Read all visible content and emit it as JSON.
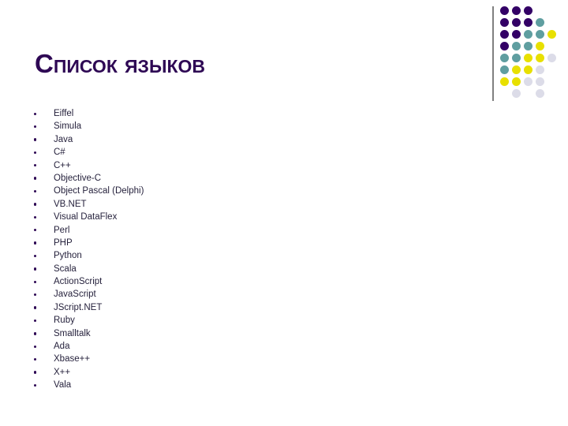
{
  "slide": {
    "title": "Список языков",
    "background_color": "#ffffff",
    "title_color": "#2E0854",
    "text_color": "#231f3a"
  },
  "languages": [
    "Eiffel",
    "Simula",
    "Java",
    "C#",
    "C++",
    "Objective-C",
    "Object Pascal (Delphi)",
    "VB.NET",
    "Visual DataFlex",
    "Perl",
    "PHP",
    "Python",
    "Scala",
    "ActionScript",
    "JavaScript",
    "JScript.NET",
    "Ruby",
    "Smalltalk",
    "Ada",
    "Xbase++",
    "X++",
    "Vala"
  ],
  "decoration": {
    "name": "dot-grid-decoration",
    "rule_color": "#808080",
    "palette": {
      "purple": "#330066",
      "teal": "#5f9ea0",
      "yellow": "#e8e000",
      "lavender": "#dcdce8"
    },
    "columns": 5,
    "rows": 8,
    "cell_pitch": 15,
    "dot_diameter": 11,
    "grid": [
      [
        "purple",
        "purple",
        "purple",
        null,
        null
      ],
      [
        "purple",
        "purple",
        "purple",
        "teal",
        null
      ],
      [
        "purple",
        "purple",
        "teal",
        "teal",
        "yellow"
      ],
      [
        "purple",
        "teal",
        "teal",
        "yellow",
        null
      ],
      [
        "teal",
        "teal",
        "yellow",
        "yellow",
        "lavender"
      ],
      [
        "teal",
        "yellow",
        "yellow",
        "lavender",
        null
      ],
      [
        "yellow",
        "yellow",
        "lavender",
        "lavender",
        null
      ],
      [
        null,
        "lavender",
        null,
        "lavender",
        null
      ]
    ]
  }
}
